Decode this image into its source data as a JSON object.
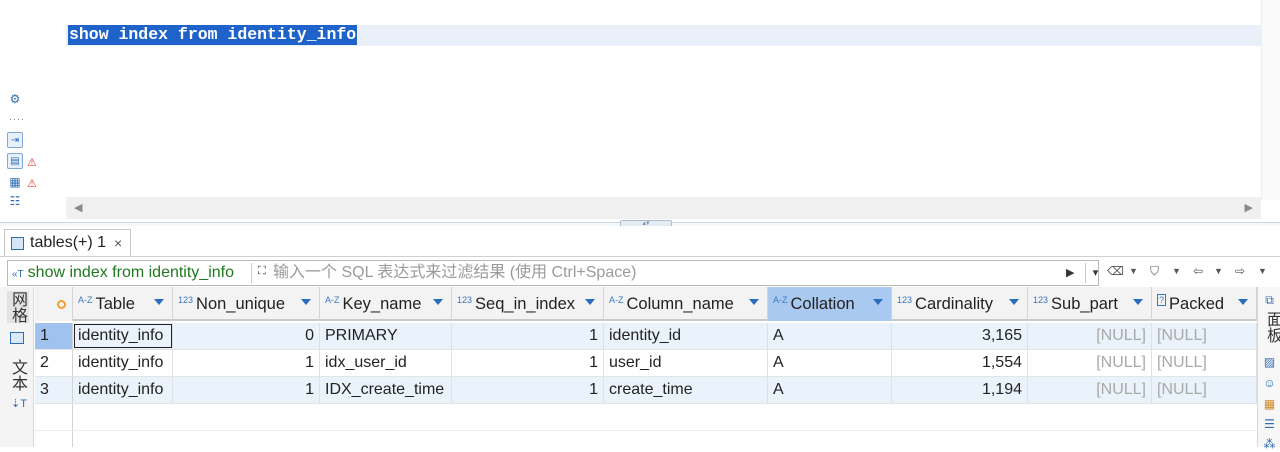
{
  "editor": {
    "sql_text": "show index from identity_info"
  },
  "results_tab": {
    "label": "tables(+) 1",
    "close_glyph": "×"
  },
  "filter": {
    "current_sql": "show index from identity_info",
    "placeholder": "输入一个 SQL 表达式来过滤结果 (使用 Ctrl+Space)"
  },
  "left_panel": {
    "tab_grid": "网格",
    "tab_text": "文本"
  },
  "right_panel": {
    "tab_panels": "面板"
  },
  "grid": {
    "columns": [
      {
        "type": "A-Z",
        "name": "Table"
      },
      {
        "type": "123",
        "name": "Non_unique"
      },
      {
        "type": "A-Z",
        "name": "Key_name"
      },
      {
        "type": "123",
        "name": "Seq_in_index"
      },
      {
        "type": "A-Z",
        "name": "Column_name"
      },
      {
        "type": "A-Z",
        "name": "Collation"
      },
      {
        "type": "123",
        "name": "Cardinality"
      },
      {
        "type": "123",
        "name": "Sub_part"
      },
      {
        "type": "?",
        "name": "Packed"
      }
    ],
    "rows": [
      {
        "num": "1",
        "table": "identity_info",
        "non_unique": "0",
        "key_name": "PRIMARY",
        "seq": "1",
        "column": "identity_id",
        "collation": "A",
        "cardinality": "3,165",
        "sub_part": "[NULL]",
        "packed": "[NULL]"
      },
      {
        "num": "2",
        "table": "identity_info",
        "non_unique": "1",
        "key_name": "idx_user_id",
        "seq": "1",
        "column": "user_id",
        "collation": "A",
        "cardinality": "1,554",
        "sub_part": "[NULL]",
        "packed": "[NULL]"
      },
      {
        "num": "3",
        "table": "identity_info",
        "non_unique": "1",
        "key_name": "IDX_create_time",
        "seq": "1",
        "column": "create_time",
        "collation": "A",
        "cardinality": "1,194",
        "sub_part": "[NULL]",
        "packed": "[NULL]"
      }
    ]
  },
  "colors": {
    "selection": "#1f62c9",
    "row_alt": "#eaf3fc",
    "header_selected": "#a9c9f0"
  },
  "icons": [
    "gear-icon",
    "script-icon",
    "warning-icon",
    "filter-icon",
    "eraser-icon",
    "back-icon",
    "forward-icon",
    "grid-icon",
    "text-icon"
  ]
}
